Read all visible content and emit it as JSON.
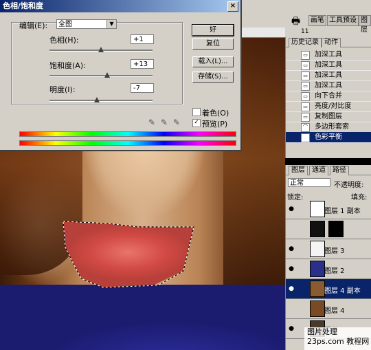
{
  "dialog": {
    "title": "色相/饱和度",
    "close": "×",
    "edit_label": "编辑(E):",
    "edit_value": "全图",
    "hue_label": "色相(H):",
    "hue_value": "+1",
    "hue_level": 0.5,
    "saturation_label": "饱和度(A):",
    "saturation_value": "+13",
    "saturation_level": 0.56,
    "lightness_label": "明度(I):",
    "lightness_value": "-7",
    "lightness_level": 0.46,
    "ok": "好",
    "reset": "复位",
    "load": "载入(L)...",
    "save": "存储(S)...",
    "colorize_label": "着色(O)",
    "colorize_checked": false,
    "preview_label": "预览(P)",
    "preview_checked": true
  },
  "top_tabs": [
    "画笔",
    "工具预设",
    "图层"
  ],
  "ruler_label": "11",
  "history": {
    "tabs": [
      "历史记录",
      "动作"
    ],
    "items": [
      {
        "label": "加深工具",
        "icon": "history-step-icon"
      },
      {
        "label": "加深工具",
        "icon": "history-step-icon"
      },
      {
        "label": "加深工具",
        "icon": "history-step-icon"
      },
      {
        "label": "加深工具",
        "icon": "history-step-icon"
      },
      {
        "label": "向下合并",
        "icon": "history-step-icon"
      },
      {
        "label": "亮度/对比度",
        "icon": "history-step-icon"
      },
      {
        "label": "复制图层",
        "icon": "history-step-icon"
      },
      {
        "label": "多边形套索",
        "icon": "lasso-icon"
      },
      {
        "label": "色彩平衡",
        "icon": "history-step-icon",
        "selected": true
      }
    ]
  },
  "layers": {
    "tabs": [
      "图层",
      "通道",
      "路径"
    ],
    "blend_mode": "正常",
    "opacity_label": "不透明度:",
    "lock_label": "锁定:",
    "fill_label": "填充:",
    "items": [
      {
        "name": "图层 1 副本",
        "visible": true
      },
      {
        "name": "",
        "visible": false,
        "mask": true
      },
      {
        "name": "图层 3",
        "visible": true
      },
      {
        "name": "图层 2",
        "visible": true
      },
      {
        "name": "图层 4 副本",
        "visible": true,
        "selected": true
      },
      {
        "name": "图层 4",
        "visible": false
      },
      {
        "name": "图层",
        "visible": true
      }
    ]
  },
  "watermark": {
    "line1": "图片处理",
    "line2": "23ps.com 教程网"
  }
}
